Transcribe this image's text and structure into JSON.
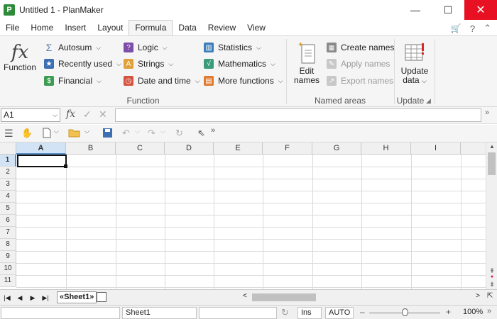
{
  "window": {
    "title": "Untitled 1 - PlanMaker",
    "app_icon_letter": "P",
    "minimize": "—",
    "maximize": "☐",
    "close": "✕"
  },
  "menu": {
    "tabs": [
      "File",
      "Home",
      "Insert",
      "Layout",
      "Formula",
      "Data",
      "Review",
      "View"
    ],
    "active_tab": "Formula",
    "cart_icon": "🛒",
    "help": "?",
    "collapse": "⌃"
  },
  "ribbon": {
    "function_group": {
      "label": "Function",
      "insert_function": "Function",
      "buttons": [
        {
          "label": "Autosum",
          "icon": "sigma-icon"
        },
        {
          "label": "Recently used",
          "icon": "recent-icon"
        },
        {
          "label": "Financial",
          "icon": "dollar-icon"
        },
        {
          "label": "Logic",
          "icon": "logic-icon"
        },
        {
          "label": "Strings",
          "icon": "strings-icon"
        },
        {
          "label": "Date and time",
          "icon": "clock-icon"
        },
        {
          "label": "Statistics",
          "icon": "statistics-icon"
        },
        {
          "label": "Mathematics",
          "icon": "math-icon"
        },
        {
          "label": "More functions",
          "icon": "more-functions-icon"
        }
      ]
    },
    "named_areas_group": {
      "label": "Named areas",
      "edit_names": [
        "Edit",
        "names"
      ],
      "create_names": "Create names",
      "apply_names": "Apply names",
      "export_names": "Export names"
    },
    "update_group": {
      "label": "Update",
      "update_data": [
        "Update",
        "data"
      ]
    },
    "colors": {
      "autosum": "#5a7fb0",
      "recent": "#3d6fb3",
      "financial": "#3d9b52",
      "logic": "#7d4ea8",
      "strings": "#e0a13a",
      "datetime": "#d65340",
      "statistics": "#3c7fb8",
      "math": "#3c9b7a",
      "more": "#e07a2f"
    }
  },
  "formula_bar": {
    "name_box": "A1",
    "fx": "fx",
    "accept": "✓",
    "cancel": "✕",
    "content": ""
  },
  "grid": {
    "columns": [
      "A",
      "B",
      "C",
      "D",
      "E",
      "F",
      "G",
      "H",
      "I"
    ],
    "rows": [
      "1",
      "2",
      "3",
      "4",
      "5",
      "6",
      "7",
      "8",
      "9",
      "10",
      "11"
    ],
    "active_cell": "A1"
  },
  "sheets": {
    "tabs": [
      "«Sheet1»"
    ]
  },
  "status": {
    "sheet_name": "Sheet1",
    "mode": "Ins",
    "calc": "AUTO",
    "zoom": "100%",
    "zoom_minus": "–",
    "zoom_plus": "+"
  }
}
